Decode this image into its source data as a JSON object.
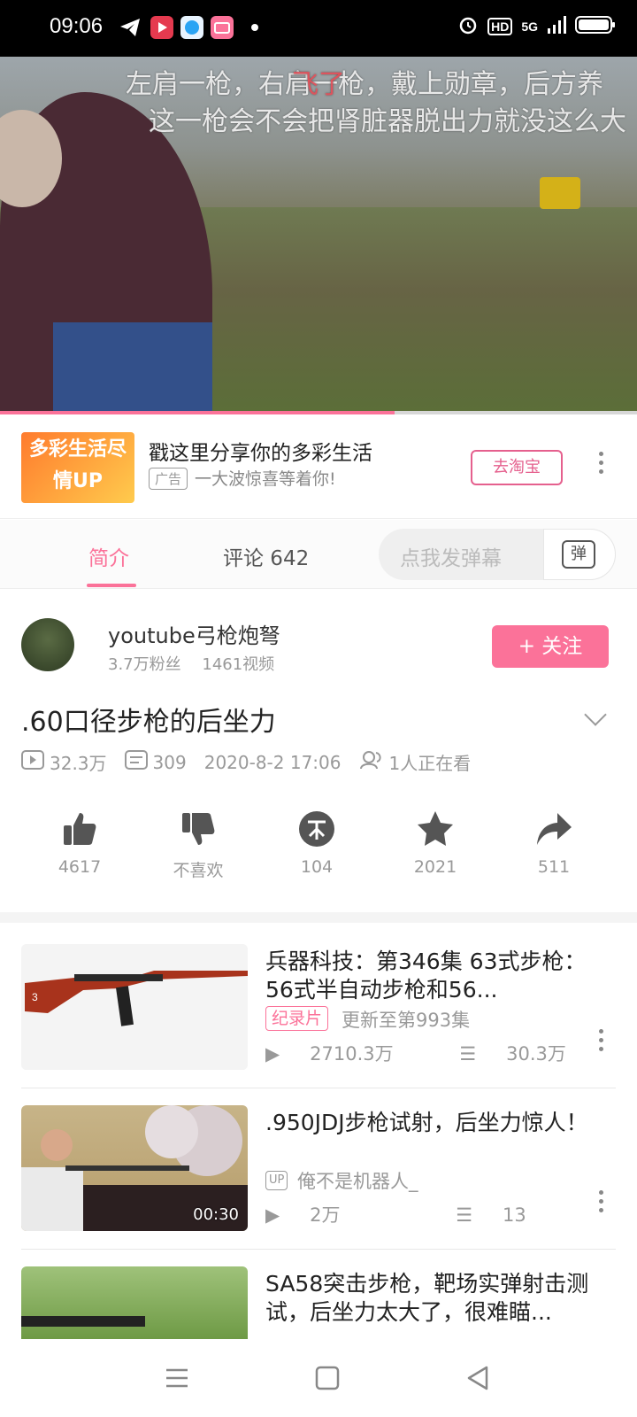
{
  "status_bar": {
    "time": "09:06",
    "hd": "HD",
    "network": "5G"
  },
  "video": {
    "danmaku": [
      "左肩一枪，右肩一枪，戴上勋章，后方养",
      "这一枪会不会把肾脏器脱出力就没这么大",
      "飞了"
    ],
    "progress": 0.62
  },
  "ad": {
    "thumb_text": "多彩生活尽情UP",
    "title": "戳这里分享你的多彩生活",
    "tag": "广告",
    "subtitle": "一大波惊喜等着你!",
    "button": "去淘宝"
  },
  "tabs": {
    "intro": "简介",
    "comments": "评论 642",
    "danmaku_placeholder": "点我发弹幕",
    "danmaku_send": "弹"
  },
  "uploader": {
    "name": "youtube弓枪炮弩",
    "fans": "3.7万粉丝",
    "videos": "1461视频",
    "follow": "+ 关注"
  },
  "video_info": {
    "title": ".60口径步枪的后坐力",
    "views": "32.3万",
    "danmaku_count": "309",
    "date": "2020-8-2 17:06",
    "watching": "1人正在看"
  },
  "actions": [
    {
      "name": "like",
      "label": "4617",
      "icon": "thumbs-up"
    },
    {
      "name": "dislike",
      "label": "不喜欢",
      "icon": "thumbs-down"
    },
    {
      "name": "coin",
      "label": "104",
      "icon": "coin"
    },
    {
      "name": "favorite",
      "label": "2021",
      "icon": "star"
    },
    {
      "name": "share",
      "label": "511",
      "icon": "share"
    }
  ],
  "related": [
    {
      "title": "兵器科技：第346集 63式步枪：56式半自动步枪和56...",
      "badge": "纪录片",
      "update": "更新至第993集",
      "views": "2710.3万",
      "danmaku": "30.3万"
    },
    {
      "title": ".950JDJ步枪试射，后坐力惊人！",
      "up_badge": "UP",
      "uploader": "俺不是机器人_",
      "views": "2万",
      "danmaku": "13",
      "duration": "00:30"
    },
    {
      "title": "SA58突击步枪，靶场实弹射击测试，后坐力太大了，很难瞄..."
    }
  ],
  "colors": {
    "accent": "#fb7299",
    "status_bar": "#000000"
  }
}
